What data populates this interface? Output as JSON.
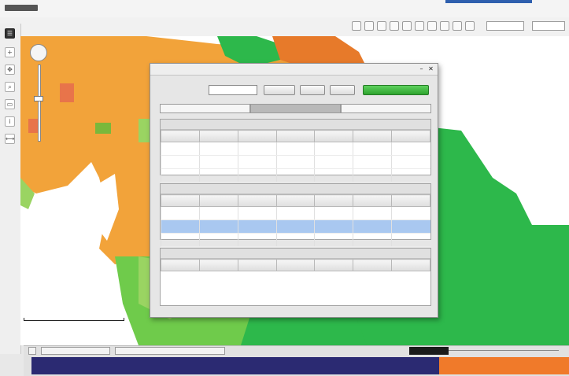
{
  "window": {
    "breadcrumb": ""
  },
  "toolbar": {
    "select1": "",
    "select2": ""
  },
  "map": {
    "colors": {
      "orange": "#f2a33a",
      "dark_orange": "#e77a2a",
      "green": "#2db84b",
      "light_green": "#6fcb4b",
      "pale_green": "#9ad462",
      "blue_sea": "#ffffff"
    },
    "scale_label": "",
    "region_labels": [
      "",
      "",
      ""
    ]
  },
  "dialog": {
    "title": "",
    "query_label": "",
    "query_value": "",
    "buttons": [
      "",
      "",
      ""
    ],
    "action_button": "",
    "tabs": [
      "",
      "",
      ""
    ],
    "sections": [
      {
        "title": "",
        "columns": [
          "",
          "",
          "",
          "",
          "",
          "",
          ""
        ],
        "rows": [
          [
            "",
            "",
            "",
            "",
            "",
            "",
            ""
          ],
          [
            "",
            "",
            "",
            "",
            "",
            "",
            ""
          ],
          [
            "",
            "",
            "",
            "",
            "",
            "",
            ""
          ]
        ]
      },
      {
        "title": "",
        "columns": [
          "",
          "",
          "",
          "",
          "",
          "",
          ""
        ],
        "rows": [
          [
            "",
            "",
            "",
            "",
            "",
            "",
            ""
          ],
          [
            "",
            "",
            "",
            "",
            "",
            "",
            ""
          ],
          [
            "",
            "",
            "",
            "",
            "",
            "",
            ""
          ]
        ],
        "selected_row": 1
      },
      {
        "title": "",
        "columns": [
          "",
          "",
          "",
          "",
          "",
          "",
          ""
        ],
        "rows": []
      }
    ]
  },
  "timeline": {
    "tabs": [
      "",
      ""
    ],
    "bar_colors": {
      "main": "#2b2a72",
      "accent": "#f07a2a"
    }
  }
}
